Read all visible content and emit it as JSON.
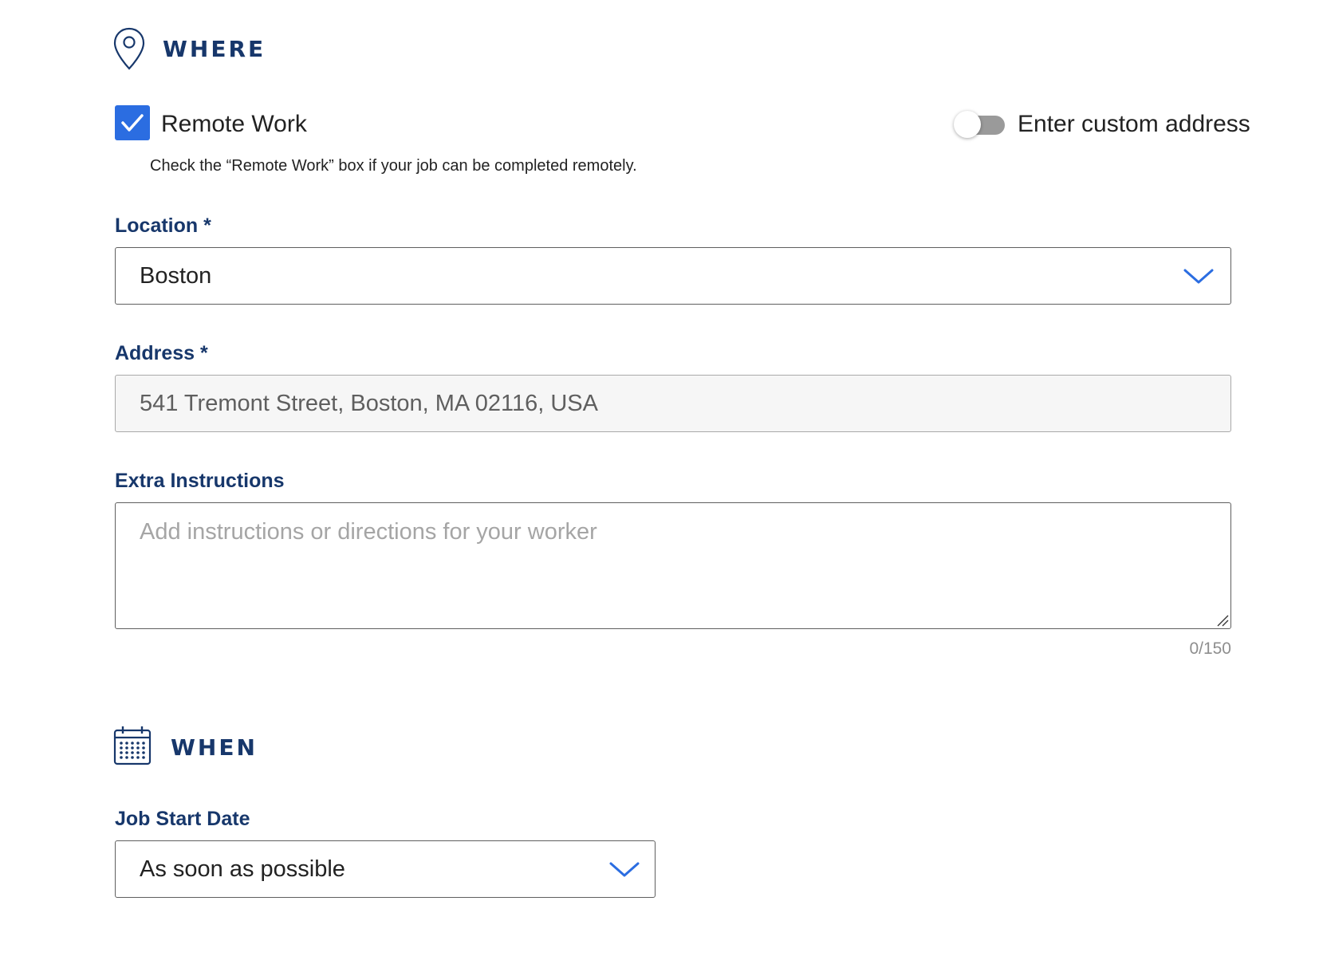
{
  "where_section": {
    "title": "WHERE",
    "icon": "location-pin-icon"
  },
  "remote_work": {
    "label": "Remote Work",
    "checked": true,
    "helper_text": "Check the “Remote Work” box if your job can be completed remotely."
  },
  "custom_address_toggle": {
    "label": "Enter custom address",
    "enabled": false
  },
  "location": {
    "label": "Location *",
    "value": "Boston",
    "icon": "chevron-down-icon"
  },
  "address": {
    "label": "Address *",
    "value": "541 Tremont Street, Boston, MA 02116, USA"
  },
  "extra_instructions": {
    "label": "Extra Instructions",
    "placeholder": "Add instructions or directions for your worker",
    "value": "",
    "counter": "0/150"
  },
  "when_section": {
    "title": "WHEN",
    "icon": "calendar-icon"
  },
  "job_start_date": {
    "label": "Job Start Date",
    "value": "As soon as possible",
    "icon": "chevron-down-icon"
  },
  "colors": {
    "heading_navy": "#17376b",
    "accent_blue": "#2b6de1",
    "toggle_off_gray": "#9a9a9a",
    "disabled_field_bg": "#f6f6f6",
    "placeholder_gray": "#a5a5a5"
  }
}
